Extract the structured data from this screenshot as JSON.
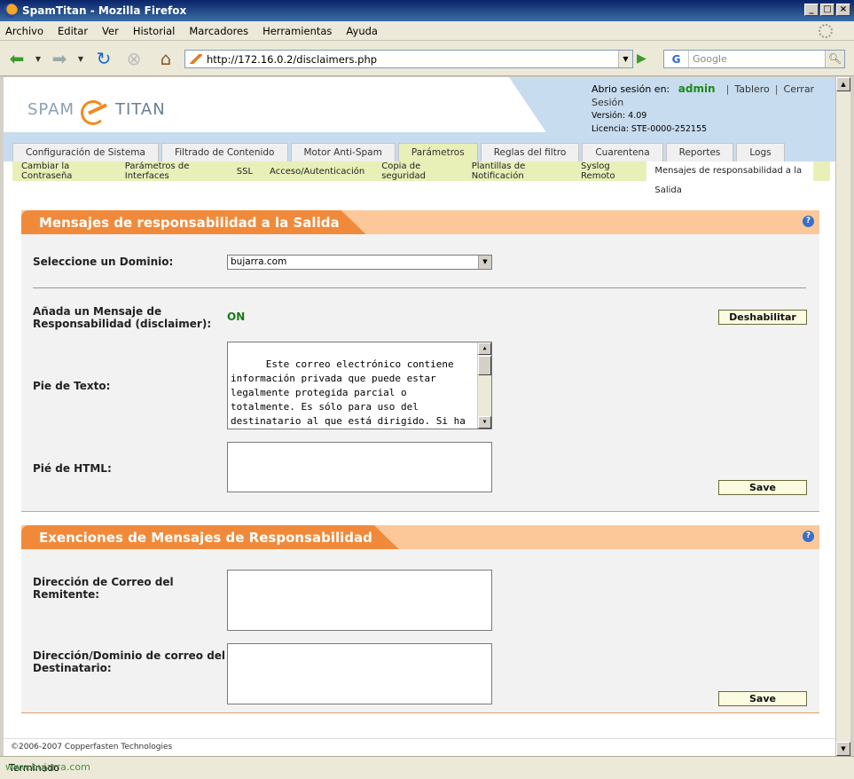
{
  "window": {
    "title": "SpamTitan - Mozilla Firefox",
    "buttons": [
      "_",
      "□",
      "×"
    ]
  },
  "menu": [
    "Archivo",
    "Editar",
    "Ver",
    "Historial",
    "Marcadores",
    "Herramientas",
    "Ayuda"
  ],
  "nav": {
    "url": "http://172.16.0.2/disclaimers.php",
    "search_placeholder": "Google",
    "search_engine_letter": "G"
  },
  "header": {
    "logo_left": "SPAM",
    "logo_right": "TITAN",
    "session_label": "Abrio sesión en:",
    "user": "admin",
    "dashboard_link": "Tablero",
    "logout_link": "Cerrar Sesión",
    "version": "Versión: 4.09",
    "license": "Licencia: STE-0000-252155"
  },
  "tabs": [
    {
      "label": "Configuración de Sistema",
      "active": false
    },
    {
      "label": "Filtrado de Contenido",
      "active": false
    },
    {
      "label": "Motor Anti-Spam",
      "active": false
    },
    {
      "label": "Parámetros",
      "active": true
    },
    {
      "label": "Reglas del filtro",
      "active": false
    },
    {
      "label": "Cuarentena",
      "active": false
    },
    {
      "label": "Reportes",
      "active": false
    },
    {
      "label": "Logs",
      "active": false
    }
  ],
  "subtabs": [
    {
      "label": "Cambiar la Contraseña",
      "active": false
    },
    {
      "label": "Parámetros de Interfaces",
      "active": false
    },
    {
      "label": "SSL",
      "active": false
    },
    {
      "label": "Acceso/Autenticación",
      "active": false
    },
    {
      "label": "Copia de seguridad",
      "active": false
    },
    {
      "label": "Plantillas de Notificación",
      "active": false
    },
    {
      "label": "Syslog Remoto",
      "active": false
    },
    {
      "label": "Mensajes de responsabilidad a la Salida",
      "active": true
    }
  ],
  "panel1": {
    "title": "Mensajes de responsabilidad a la Salida",
    "help": "?",
    "domain_label": "Seleccione un Dominio:",
    "domain_value": "bujarra.com",
    "add_label": "Añada un Mensaje de Responsabilidad (disclaimer):",
    "status": "ON",
    "disable_button": "Deshabilitar",
    "text_footer_label": "Pie de Texto:",
    "text_footer_value": "Este correo electrónico contiene información privada que puede estar legalmente protegida parcial o totalmente. Es sólo para uso del destinatario al que está dirigido. Si ha sido encaminado",
    "html_footer_label": "Pié de HTML:",
    "html_footer_value": "",
    "save_button": "Save"
  },
  "panel2": {
    "title": "Exenciones de Mensajes de Responsabilidad",
    "help": "?",
    "sender_label": "Dirección de Correo del Remitente:",
    "sender_value": "",
    "recipient_label": "Dirección/Dominio de correo del Destinatario:",
    "recipient_value": "",
    "save_button": "Save"
  },
  "footer": "©2006-2007 Copperfasten Technologies",
  "status": {
    "text": "Terminado",
    "watermark": "www.bujarra.com"
  }
}
